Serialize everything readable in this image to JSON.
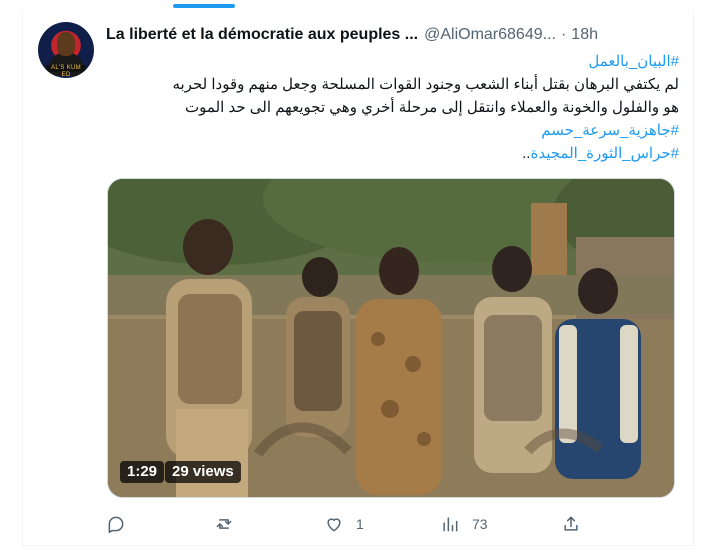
{
  "colors": {
    "accent": "#1d9bf0",
    "text": "#0f1419",
    "muted": "#536471",
    "border": "#eff3f4"
  },
  "avatar": {
    "icon": "profile-avatar",
    "label_text": "AL'S KUM ED"
  },
  "tweet": {
    "display_name": "La liberté et la démocratie aux peuples ...",
    "handle": "@AliOmar68649...",
    "separator": "·",
    "time": "18h",
    "hashtag_1": "#البيان_بالعمل",
    "text_line_1": "لم يكتفي البرهان بقتل أبناء الشعب وجنود القوات المسلحة وجعل منهم وقودا لحربه",
    "text_line_2": "هو والفلول والخونة والعملاء وانتقل إلى مرحلة أخري وهي تجويعهم الى حد الموت",
    "hashtag_2": "#جاهزية_سرعة_حسم",
    "hashtag_3": "#حراس_الثورة_المجيدة",
    "hashtag_3_suffix": ".."
  },
  "media": {
    "icon": "video-thumbnail",
    "duration": "1:29",
    "views": "29 views"
  },
  "actions": {
    "reply": {
      "icon": "reply-icon",
      "count": ""
    },
    "repost": {
      "icon": "repost-icon",
      "count": ""
    },
    "like": {
      "icon": "heart-icon",
      "count": "1"
    },
    "views": {
      "icon": "views-chart-icon",
      "count": "73"
    },
    "share": {
      "icon": "share-icon",
      "count": ""
    }
  }
}
